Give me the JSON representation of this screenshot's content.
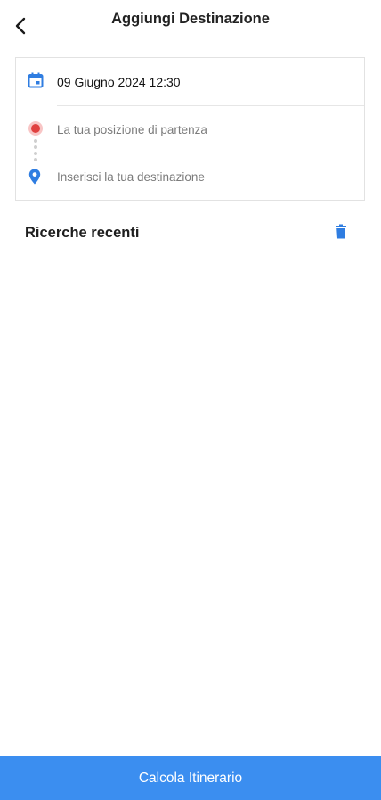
{
  "header": {
    "title": "Aggiungi Destinazione"
  },
  "trip_form": {
    "date_time": "09 Giugno 2024 12:30",
    "start_placeholder": "La tua posizione di partenza",
    "destination_placeholder": "Inserisci la tua destinazione"
  },
  "recent": {
    "title": "Ricerche recenti"
  },
  "footer": {
    "cta_label": "Calcola Itinerario"
  },
  "colors": {
    "accent": "#3b8ef0",
    "icon_blue": "#2f7de1",
    "start_dot": "#e0403f"
  },
  "icons": [
    "back-chevron-icon",
    "calendar-icon",
    "start-location-dot-icon",
    "location-pin-icon",
    "trash-icon"
  ]
}
